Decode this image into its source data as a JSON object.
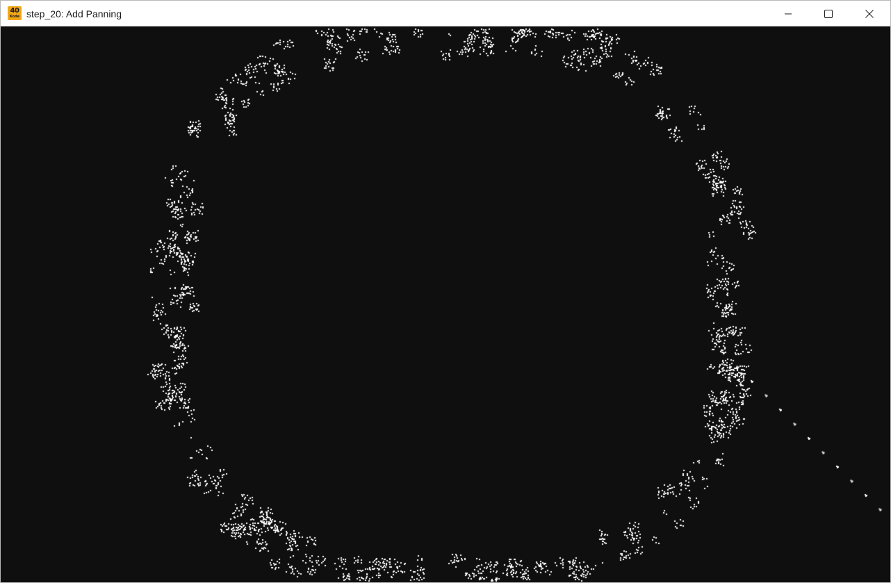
{
  "window": {
    "title": "step_20: Add Panning",
    "app_icon": {
      "name": "app-logo-icon",
      "text_top": "40",
      "text_bottom": "Kode",
      "color": "#f2a71b"
    },
    "controls": {
      "minimize_icon": "minimize-icon",
      "maximize_icon": "maximize-icon",
      "close_icon": "close-icon"
    }
  },
  "canvas": {
    "background": "#0f0f0f",
    "cell_color": "#ffffff",
    "description_icon": "game-of-life-grid"
  }
}
